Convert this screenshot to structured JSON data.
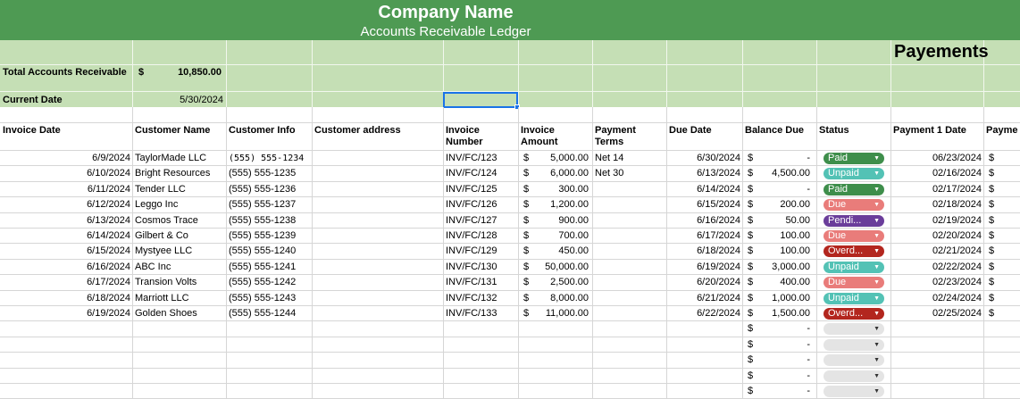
{
  "header": {
    "company_name": "Company Name",
    "subtitle": "Accounts Receivable Ledger"
  },
  "summary": {
    "total_label": "Total Accounts Receivable",
    "total_currency": "$",
    "total_value": "10,850.00",
    "date_label": "Current Date",
    "date_value": "5/30/2024",
    "payments_title": "Payements"
  },
  "columns": [
    "Invoice Date",
    "Customer Name",
    "Customer Info",
    "Customer address",
    "Invoice Number",
    "Invoice Amount",
    "Payment Terms",
    "Due Date",
    "Balance Due",
    "Status",
    "Payment 1 Date",
    "Payme"
  ],
  "rows": [
    {
      "invoice_date": "6/9/2024",
      "customer": "TaylorMade LLC",
      "info": "(555) 555-1234",
      "address": "",
      "number": "INV/FC/123",
      "amount": "5,000.00",
      "terms": "Net 14",
      "due": "6/30/2024",
      "balance": "-",
      "status": "Paid",
      "pay1_date": "06/23/2024"
    },
    {
      "invoice_date": "6/10/2024",
      "customer": "Bright Resources",
      "info": "(555) 555-1235",
      "address": "",
      "number": "INV/FC/124",
      "amount": "6,000.00",
      "terms": "Net 30",
      "due": "6/13/2024",
      "balance": "4,500.00",
      "status": "Unpaid",
      "pay1_date": "02/16/2024"
    },
    {
      "invoice_date": "6/11/2024",
      "customer": "Tender LLC",
      "info": "(555) 555-1236",
      "address": "",
      "number": "INV/FC/125",
      "amount": "300.00",
      "terms": "",
      "due": "6/14/2024",
      "balance": "-",
      "status": "Paid",
      "pay1_date": "02/17/2024"
    },
    {
      "invoice_date": "6/12/2024",
      "customer": "Leggo Inc",
      "info": "(555) 555-1237",
      "address": "",
      "number": "INV/FC/126",
      "amount": "1,200.00",
      "terms": "",
      "due": "6/15/2024",
      "balance": "200.00",
      "status": "Due",
      "pay1_date": "02/18/2024"
    },
    {
      "invoice_date": "6/13/2024",
      "customer": "Cosmos Trace",
      "info": "(555) 555-1238",
      "address": "",
      "number": "INV/FC/127",
      "amount": "900.00",
      "terms": "",
      "due": "6/16/2024",
      "balance": "50.00",
      "status": "Pendi...",
      "pay1_date": "02/19/2024"
    },
    {
      "invoice_date": "6/14/2024",
      "customer": "Gilbert & Co",
      "info": "(555) 555-1239",
      "address": "",
      "number": "INV/FC/128",
      "amount": "700.00",
      "terms": "",
      "due": "6/17/2024",
      "balance": "100.00",
      "status": "Due",
      "pay1_date": "02/20/2024"
    },
    {
      "invoice_date": "6/15/2024",
      "customer": "Mystyee LLC",
      "info": "(555) 555-1240",
      "address": "",
      "number": "INV/FC/129",
      "amount": "450.00",
      "terms": "",
      "due": "6/18/2024",
      "balance": "100.00",
      "status": "Overd...",
      "pay1_date": "02/21/2024"
    },
    {
      "invoice_date": "6/16/2024",
      "customer": "ABC Inc",
      "info": "(555) 555-1241",
      "address": "",
      "number": "INV/FC/130",
      "amount": "50,000.00",
      "terms": "",
      "due": "6/19/2024",
      "balance": "3,000.00",
      "status": "Unpaid",
      "pay1_date": "02/22/2024"
    },
    {
      "invoice_date": "6/17/2024",
      "customer": "Transion Volts",
      "info": "(555) 555-1242",
      "address": "",
      "number": "INV/FC/131",
      "amount": "2,500.00",
      "terms": "",
      "due": "6/20/2024",
      "balance": "400.00",
      "status": "Due",
      "pay1_date": "02/23/2024"
    },
    {
      "invoice_date": "6/18/2024",
      "customer": "Marriott LLC",
      "info": "(555) 555-1243",
      "address": "",
      "number": "INV/FC/132",
      "amount": "8,000.00",
      "terms": "",
      "due": "6/21/2024",
      "balance": "1,000.00",
      "status": "Unpaid",
      "pay1_date": "02/24/2024"
    },
    {
      "invoice_date": "6/19/2024",
      "customer": "Golden Shoes",
      "info": "(555) 555-1244",
      "address": "",
      "number": "INV/FC/133",
      "amount": "11,000.00",
      "terms": "",
      "due": "6/22/2024",
      "balance": "1,500.00",
      "status": "Overd...",
      "pay1_date": "02/25/2024"
    }
  ],
  "empty_rows": [
    {
      "currency": "$",
      "balance": "-"
    },
    {
      "currency": "$",
      "balance": "-"
    },
    {
      "currency": "$",
      "balance": "-"
    },
    {
      "currency": "$",
      "balance": "-"
    },
    {
      "currency": "$",
      "balance": "-"
    }
  ],
  "currency_symbol": "$",
  "status_colors": {
    "Paid": "#3e8e4b",
    "Unpaid": "#53c2b5",
    "Due": "#e97c7a",
    "Pendi...": "#6a3d9a",
    "Overd...": "#b3261e"
  },
  "icons": {
    "dropdown": "chevron-down-icon"
  }
}
